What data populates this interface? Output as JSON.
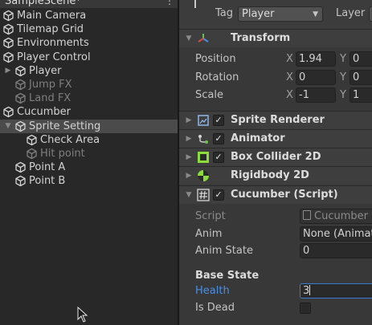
{
  "hierarchy": {
    "scene_name": "SampleScene*",
    "menu_icon": "⋮",
    "items": [
      {
        "label": "Main Camera",
        "depth": 0,
        "arrow": "",
        "dim": false,
        "selected": false,
        "icon": "gameobject-icon"
      },
      {
        "label": "Tilemap Grid",
        "depth": 0,
        "arrow": "",
        "dim": false,
        "selected": false,
        "icon": "gameobject-icon"
      },
      {
        "label": "Environments",
        "depth": 0,
        "arrow": "",
        "dim": false,
        "selected": false,
        "icon": "gameobject-icon"
      },
      {
        "label": "Player Control",
        "depth": 0,
        "arrow": "",
        "dim": false,
        "selected": false,
        "icon": "gameobject-icon"
      },
      {
        "label": "Player",
        "depth": 1,
        "arrow": "▶",
        "dim": false,
        "selected": false,
        "icon": "gameobject-icon"
      },
      {
        "label": "Jump FX",
        "depth": 1,
        "arrow": "",
        "dim": true,
        "selected": false,
        "icon": "gameobject-icon"
      },
      {
        "label": "Land FX",
        "depth": 1,
        "arrow": "",
        "dim": true,
        "selected": false,
        "icon": "gameobject-icon"
      },
      {
        "label": "Cucumber",
        "depth": 0,
        "arrow": "",
        "dim": false,
        "selected": false,
        "icon": "gameobject-icon"
      },
      {
        "label": "Sprite Setting",
        "depth": 1,
        "arrow": "▼",
        "dim": false,
        "selected": true,
        "icon": "gameobject-icon"
      },
      {
        "label": "Check Area",
        "depth": 2,
        "arrow": "",
        "dim": false,
        "selected": false,
        "icon": "gameobject-icon"
      },
      {
        "label": "Hit point",
        "depth": 2,
        "arrow": "",
        "dim": true,
        "selected": false,
        "icon": "gameobject-icon"
      },
      {
        "label": "Point A",
        "depth": 1,
        "arrow": "",
        "dim": false,
        "selected": false,
        "icon": "gameobject-icon"
      },
      {
        "label": "Point B",
        "depth": 1,
        "arrow": "",
        "dim": false,
        "selected": false,
        "icon": "gameobject-icon"
      }
    ]
  },
  "inspector": {
    "tag_label": "Tag",
    "tag_value": "Player",
    "layer_label": "Layer",
    "transform": {
      "title": "Transform",
      "position": {
        "label": "Position",
        "x_axis": "X",
        "x": "1.94",
        "y_axis": "Y",
        "y": "0"
      },
      "rotation": {
        "label": "Rotation",
        "x_axis": "X",
        "x": "0",
        "y_axis": "Y",
        "y": "0"
      },
      "scale": {
        "label": "Scale",
        "x_axis": "X",
        "x": "-1",
        "y_axis": "Y",
        "y": "1"
      }
    },
    "components": {
      "sprite_renderer": "Sprite Renderer",
      "animator": "Animator",
      "box_collider": "Box Collider 2D",
      "rigidbody": "Rigidbody 2D",
      "cucumber_script": "Cucumber (Script)"
    },
    "script_props": {
      "script_label": "Script",
      "script_value": "Cucumber",
      "anim_label": "Anim",
      "anim_value": "None (Animato",
      "anim_state_label": "Anim State",
      "anim_state_value": "0",
      "base_state_heading": "Base State",
      "health_label": "Health",
      "health_value": "3",
      "is_dead_label": "Is Dead"
    },
    "colors": {
      "panel_bg": "#383838",
      "hierarchy_bg": "#282828",
      "selection": "#4b4b4b",
      "focus_blue": "#3b7bd4",
      "label_blue": "#4c8fe0",
      "transform_icon_red": "#e0453a",
      "transform_icon_green": "#6bc24a",
      "transform_icon_blue": "#4a8fe0",
      "box_collider_green": "#8ddc3a",
      "rigidbody_green": "#8ddc3a"
    }
  }
}
